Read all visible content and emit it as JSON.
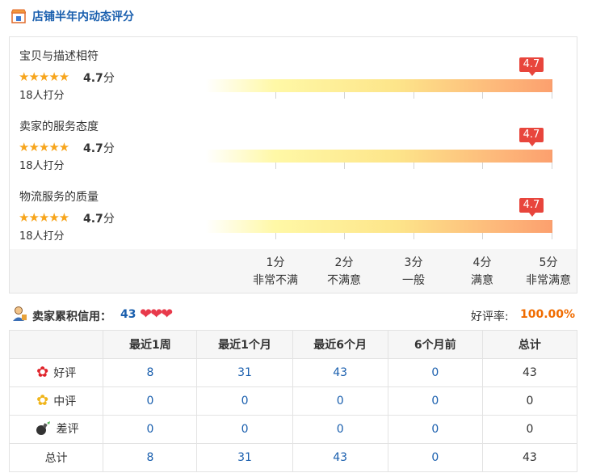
{
  "header": {
    "title": "店铺半年内动态评分",
    "icon": "store-icon"
  },
  "ratings": [
    {
      "title": "宝贝与描述相符",
      "stars": "★★★★★",
      "score": "4.7",
      "unit": "分",
      "count": "18人打分",
      "badge": "4.7",
      "value": 4.7
    },
    {
      "title": "卖家的服务态度",
      "stars": "★★★★★",
      "score": "4.7",
      "unit": "分",
      "count": "18人打分",
      "badge": "4.7",
      "value": 4.7
    },
    {
      "title": "物流服务的质量",
      "stars": "★★★★★",
      "score": "4.7",
      "unit": "分",
      "count": "18人打分",
      "badge": "4.7",
      "value": 4.7
    }
  ],
  "scale": [
    {
      "score": "1分",
      "desc": "非常不满"
    },
    {
      "score": "2分",
      "desc": "不满意"
    },
    {
      "score": "3分",
      "desc": "一般"
    },
    {
      "score": "4分",
      "desc": "满意"
    },
    {
      "score": "5分",
      "desc": "非常满意"
    }
  ],
  "credit": {
    "title": "卖家累积信用：",
    "value": "43",
    "hearts": "❤❤❤",
    "rate_label": "好评率:",
    "rate_value": "100.00%"
  },
  "table": {
    "headers": [
      "",
      "最近1周",
      "最近1个月",
      "最近6个月",
      "6个月前",
      "总计"
    ],
    "rows": [
      {
        "label": "好评",
        "icon": "red-flower-icon",
        "cells": [
          "8",
          "31",
          "43",
          "0",
          "43"
        ]
      },
      {
        "label": "中评",
        "icon": "yellow-flower-icon",
        "cells": [
          "0",
          "0",
          "0",
          "0",
          "0"
        ]
      },
      {
        "label": "差评",
        "icon": "bomb-icon",
        "cells": [
          "0",
          "0",
          "0",
          "0",
          "0"
        ]
      },
      {
        "label": "总计",
        "icon": "",
        "cells": [
          "8",
          "31",
          "43",
          "0",
          "43"
        ]
      }
    ]
  },
  "colors": {
    "accent": "#1a5fae",
    "badge": "#e8453c",
    "star": "#f7a51c",
    "rate": "#f06c00"
  }
}
